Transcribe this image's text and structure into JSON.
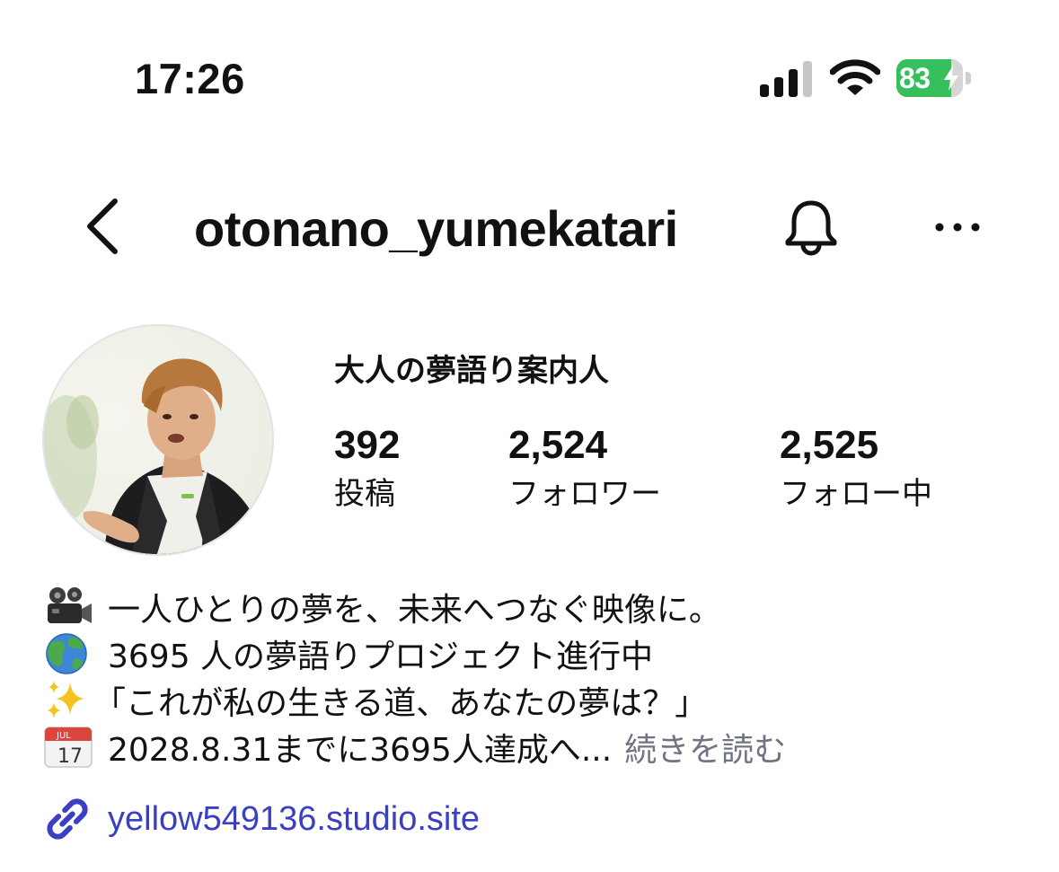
{
  "status_bar": {
    "time": "17:26",
    "battery_level": "83",
    "battery_charging": true
  },
  "header": {
    "username": "otonano_yumekatari",
    "icons": [
      "back-icon",
      "bell-icon",
      "more-icon"
    ]
  },
  "profile": {
    "display_name": "大人の夢語り案内人",
    "stats": {
      "posts": {
        "count": "392",
        "label": "投稿"
      },
      "followers": {
        "count": "2,524",
        "label": "フォロワー"
      },
      "following": {
        "count": "2,525",
        "label": "フォロー中"
      }
    }
  },
  "bio": {
    "lines": [
      {
        "icon": "movie-camera-icon",
        "text": "一人ひとりの夢を、未来へつなぐ映像に。"
      },
      {
        "icon": "globe-icon",
        "text": "3695 人の夢語りプロジェクト進行中"
      },
      {
        "icon": "sparkles-icon",
        "text": "「これが私の生きる道、あなたの夢は？」"
      },
      {
        "icon": "calendar-icon",
        "text": "2028.8.31までに3695人達成へ..."
      }
    ],
    "more_label": "続きを読む",
    "calendar_month": "JUL",
    "calendar_day": "17"
  },
  "link": {
    "icon": "link-icon",
    "text": "yellow549136.studio.site"
  },
  "colors": {
    "battery_green": "#36c05d",
    "link_blue": "#3a3fc4",
    "muted_gray": "#707380"
  }
}
